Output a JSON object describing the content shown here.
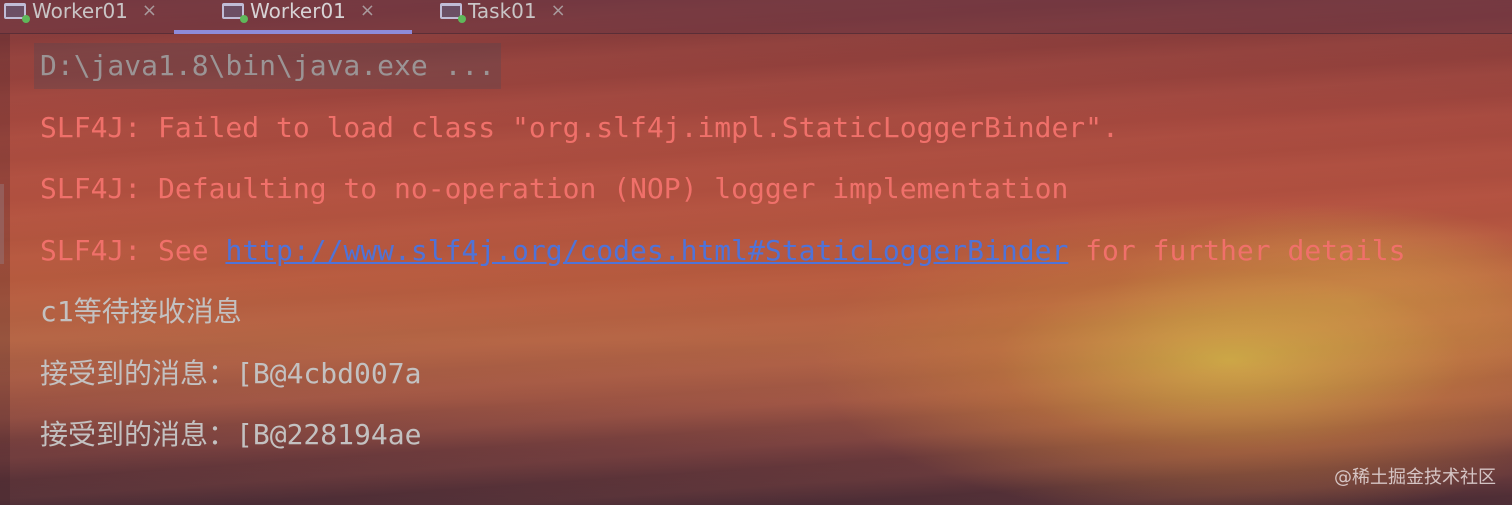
{
  "tabs": [
    {
      "label": "Worker01",
      "icon": "run-config-icon",
      "active": false
    },
    {
      "label": "Worker01",
      "icon": "run-config-icon",
      "active": true
    },
    {
      "label": "Task01",
      "icon": "run-config-icon",
      "active": false
    }
  ],
  "tab_close_glyph": "×",
  "console": {
    "command": "D:\\java1.8\\bin\\java.exe ...",
    "slf4j_1": "SLF4J: Failed to load class \"org.slf4j.impl.StaticLoggerBinder\".",
    "slf4j_2": "SLF4J: Defaulting to no-operation (NOP) logger implementation",
    "slf4j_3_prefix": "SLF4J: See ",
    "slf4j_3_link": "http://www.slf4j.org/codes.html#StaticLoggerBinder",
    "slf4j_3_suffix": " for further details",
    "out_1": "c1等待接收消息",
    "out_2": "接受到的消息：[B@4cbd007a",
    "out_3": "接受到的消息：[B@228194ae"
  },
  "watermark": "@稀土掘金技术社区",
  "colors": {
    "error_text": "#f0706a",
    "link": "#4f73d8",
    "normal_text": "#c3c1c1",
    "active_tab_underline": "#8e8bd9"
  }
}
